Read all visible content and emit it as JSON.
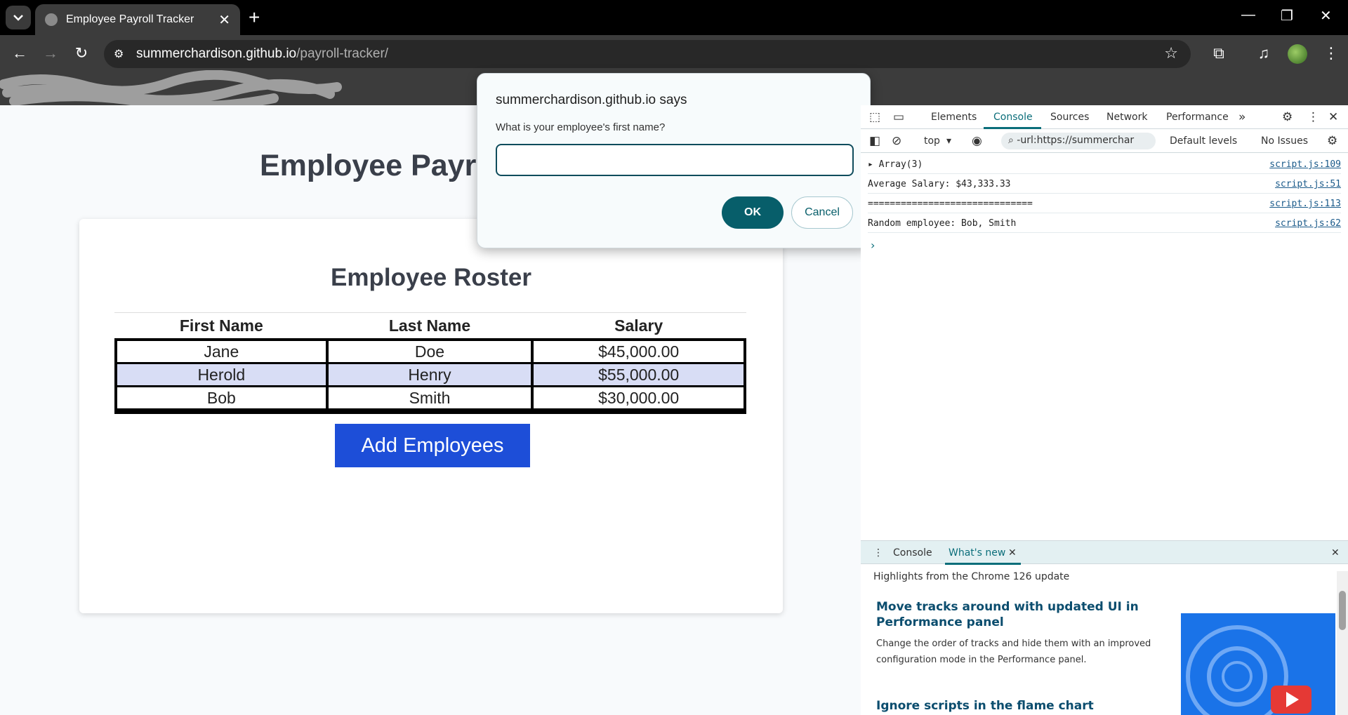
{
  "browser": {
    "tab_title": "Employee Payroll Tracker",
    "url_host": "summerchardison.github.io",
    "url_path": "/payroll-tracker/"
  },
  "page": {
    "title": "Employee Payroll Tracker",
    "roster_title": "Employee Roster",
    "columns": [
      "First Name",
      "Last Name",
      "Salary"
    ],
    "rows": [
      [
        "Jane",
        "Doe",
        "$45,000.00"
      ],
      [
        "Herold",
        "Henry",
        "$55,000.00"
      ],
      [
        "Bob",
        "Smith",
        "$30,000.00"
      ]
    ],
    "add_button": "Add Employees"
  },
  "dialog": {
    "title": "summerchardison.github.io says",
    "message": "What is your employee's first name?",
    "input_value": "",
    "ok_label": "OK",
    "cancel_label": "Cancel"
  },
  "devtools": {
    "tabs": [
      "Elements",
      "Console",
      "Sources",
      "Network",
      "Performance"
    ],
    "context": "top",
    "filter": "-url:https://summerchar",
    "levels": "Default levels",
    "issues": "No Issues",
    "console": [
      {
        "msg": "Array(3)",
        "src": "script.js:109"
      },
      {
        "msg": "Average Salary: $43,333.33",
        "src": "script.js:51"
      },
      {
        "msg": "==============================",
        "src": "script.js:113"
      },
      {
        "msg": "Random employee: Bob, Smith",
        "src": "script.js:62"
      }
    ],
    "drawer": {
      "tabs": [
        "Console",
        "What's new"
      ],
      "highlights": "Highlights from the Chrome 126 update",
      "item1_title": "Move tracks around with updated UI in Performance panel",
      "item1_body": "Change the order of tracks and hide them with an improved configuration mode in the Performance panel.",
      "item2_title": "Ignore scripts in the flame chart"
    }
  }
}
